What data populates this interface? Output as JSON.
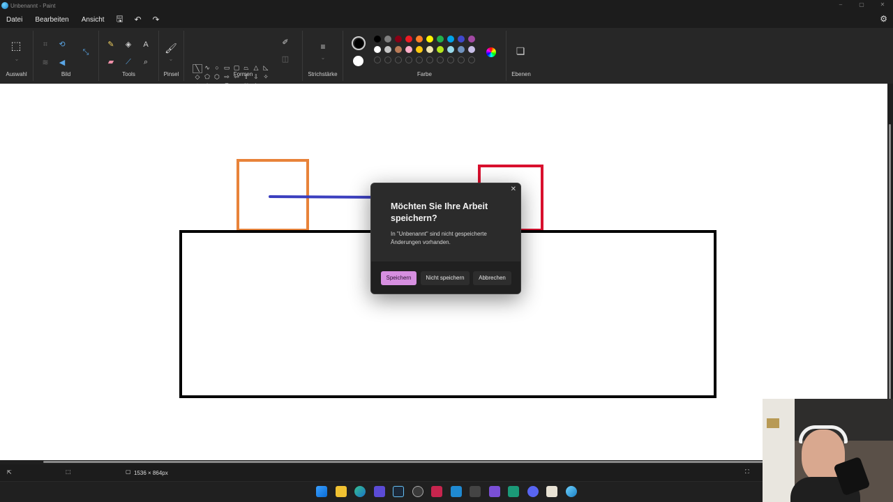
{
  "window": {
    "title": "Unbenannt - Paint",
    "controls": [
      "–",
      "▢",
      "✕"
    ]
  },
  "menu": {
    "file": "Datei",
    "edit": "Bearbeiten",
    "view": "Ansicht",
    "save_icon": "save-icon",
    "undo_icon": "undo-icon",
    "redo_icon": "redo-icon"
  },
  "ribbon": {
    "groups": {
      "selection": "Auswahl",
      "image": "Bild",
      "tools": "Tools",
      "brush": "Pinsel",
      "shapes": "Formen",
      "stroke": "Strichstärke",
      "color": "Farbe",
      "layers": "Ebenen"
    },
    "colors": {
      "primary": "#000000",
      "secondary": "#ffffff",
      "row1": [
        "#000000",
        "#7f7f7f",
        "#880015",
        "#ed1c24",
        "#ff7f27",
        "#fff200",
        "#22b14c",
        "#00a2e8",
        "#3f48cc",
        "#a349a4"
      ],
      "row2": [
        "#ffffff",
        "#c3c3c3",
        "#b97a57",
        "#ffaec9",
        "#ffc90e",
        "#efe4b0",
        "#b5e61d",
        "#99d9ea",
        "#7092be",
        "#c8bfe7"
      ]
    }
  },
  "canvas": {
    "shapes": [
      {
        "kind": "rectangle",
        "color": "#e8833a"
      },
      {
        "kind": "line",
        "color": "#3b3fbf"
      },
      {
        "kind": "rectangle",
        "color": "#d9102e"
      },
      {
        "kind": "rectangle",
        "color": "#000000"
      }
    ]
  },
  "dialog": {
    "title": "Möchten Sie Ihre Arbeit speichern?",
    "body": "In \"Unbenannt\" sind nicht gespeicherte Änderungen vorhanden.",
    "save": "Speichern",
    "dont_save": "Nicht speichern",
    "cancel": "Abbrechen",
    "accent": "#d68fe0"
  },
  "status": {
    "canvas_size": "1536 × 864px"
  }
}
